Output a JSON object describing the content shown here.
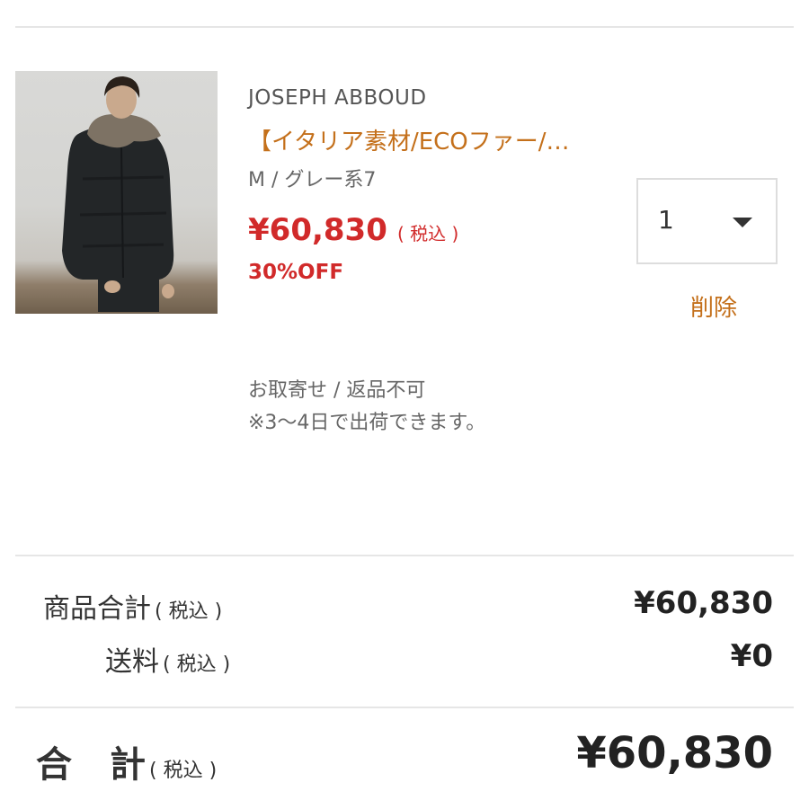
{
  "cart_item": {
    "image_alt": "Model wearing dark hooded parka with fur collar",
    "brand": "JOSEPH ABBOUD",
    "title": "【イタリア素材/ECOファー/…",
    "variant": "M / グレー系7",
    "price": "¥60,830",
    "price_tax_note": "( 税込 )",
    "discount": "30%OFF",
    "quantity": "1",
    "delete_label": "削除",
    "availability": "お取寄せ / 返品不可",
    "shipping_estimate": "※3〜4日で出荷できます。"
  },
  "summary": {
    "subtotal_label": "商品合計",
    "subtotal_tax": "( 税込 )",
    "subtotal_value": "¥60,830",
    "shipping_label": "送料",
    "shipping_tax": "( 税込 )",
    "shipping_value": "¥0",
    "total_label_1": "合",
    "total_label_2": "計",
    "total_tax": "( 税込 )",
    "total_value": "¥60,830"
  },
  "colors": {
    "accent_link": "#c4701b",
    "price_red": "#d12a2a",
    "divider": "#e6e6e6"
  },
  "icons": {
    "quantity_caret": "chevron-down-icon"
  }
}
